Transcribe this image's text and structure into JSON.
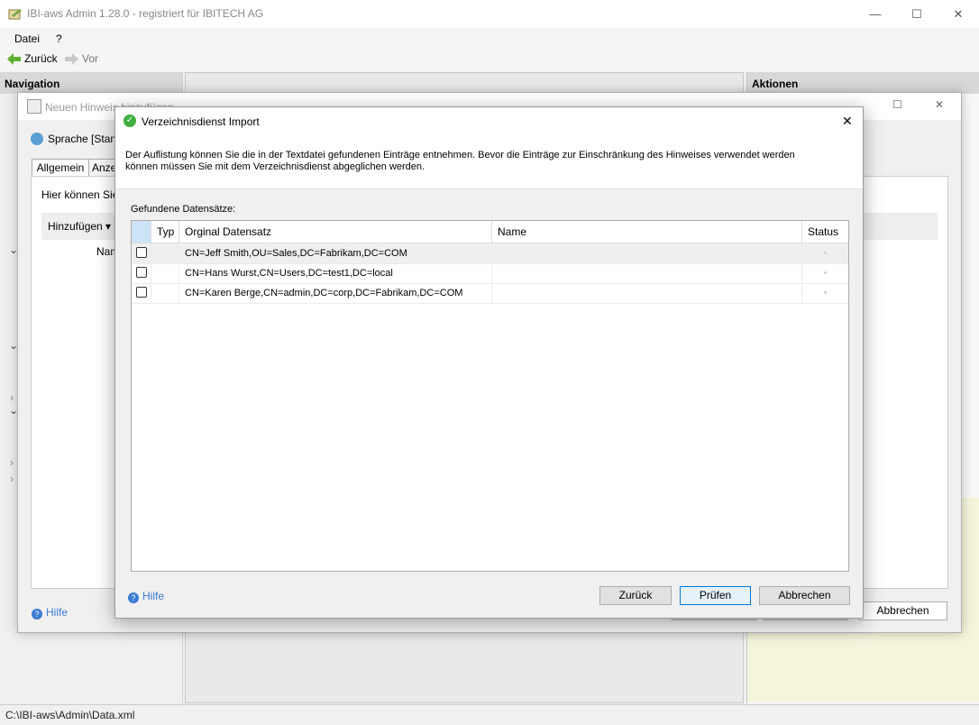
{
  "window": {
    "title": "IBI-aws Admin 1.28.0 - registriert für IBITECH AG",
    "controls": [
      "—",
      "☐",
      "✕"
    ]
  },
  "menu": {
    "file": "Datei",
    "help": "?"
  },
  "nav": {
    "back": "Zurück",
    "forward": "Vor"
  },
  "left_pane": {
    "header": "Navigation"
  },
  "right_pane": {
    "header": "Aktionen"
  },
  "status_path": "C:\\IBI-aws\\Admin\\Data.xml",
  "hint_dialog": {
    "title": "Neuen Hinweis hinzufügen",
    "language": "Sprache [Stanc",
    "tabs": [
      "Allgemein",
      "Anzei"
    ],
    "info": "Hier können Sie",
    "add_button": "Hinzufügen",
    "col_name": "Nam",
    "help": "Hilfe",
    "cancel": "Abbrechen"
  },
  "modal": {
    "title": "Verzeichnisdienst Import",
    "description_line1": "Der Auflistung können Sie die in der Textdatei gefundenen Einträge entnehmen. Bevor die Einträge zur Einschränkung des Hinweises verwendet werden",
    "description_line2": "können müssen Sie mit dem Verzeichnisdienst abgeglichen werden.",
    "found_label": "Gefundene Datensätze:",
    "columns": {
      "type": "Typ",
      "original": "Orginal Datensatz",
      "name": "Name",
      "status": "Status"
    },
    "rows": [
      {
        "original": "CN=Jeff Smith,OU=Sales,DC=Fabrikam,DC=COM",
        "name": ""
      },
      {
        "original": "CN=Hans Wurst,CN=Users,DC=test1,DC=local",
        "name": ""
      },
      {
        "original": "CN=Karen Berge,CN=admin,DC=corp,DC=Fabrikam,DC=COM",
        "name": ""
      }
    ],
    "help": "Hilfe",
    "buttons": {
      "back": "Zurück",
      "check": "Prüfen",
      "cancel": "Abbrechen"
    }
  }
}
